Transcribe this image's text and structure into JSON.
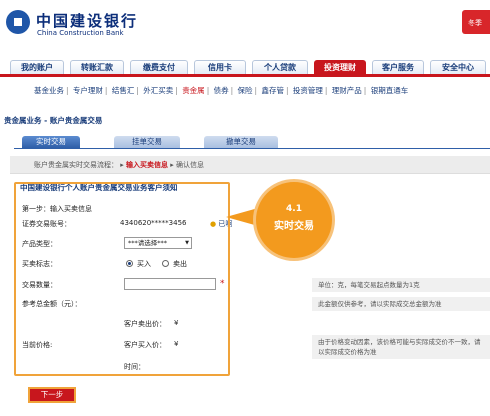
{
  "header": {
    "bank_name_cn": "中国建设银行",
    "bank_name_en": "China Construction Bank",
    "promo_text": "冬季"
  },
  "tabs": [
    {
      "label": "我的账户"
    },
    {
      "label": "转账汇款"
    },
    {
      "label": "缴费支付"
    },
    {
      "label": "信用卡"
    },
    {
      "label": "个人贷款"
    },
    {
      "label": "投资理财",
      "active": true
    },
    {
      "label": "客户服务"
    },
    {
      "label": "安全中心"
    }
  ],
  "subnav": [
    {
      "label": "基金业务"
    },
    {
      "label": "专户理财"
    },
    {
      "label": "结售汇"
    },
    {
      "label": "外汇买卖"
    },
    {
      "label": "贵金属",
      "active": true
    },
    {
      "label": "债券"
    },
    {
      "label": "保险"
    },
    {
      "label": "鑫存管"
    },
    {
      "label": "投资管理"
    },
    {
      "label": "理财产品"
    },
    {
      "label": "银期直通车"
    }
  ],
  "section_title": "贵金属业务 - 账户贵金属交易",
  "subtabs": [
    {
      "label": "实时交易",
      "active": true
    },
    {
      "label": "挂单交易"
    },
    {
      "label": "撤单交易"
    }
  ],
  "progress": {
    "prefix": "账户贵金属实时交易流程：",
    "current": "输入买卖信息",
    "next": "确认信息"
  },
  "notice_title": "中国建设银行个人账户贵金属交易业务客户须知",
  "form": {
    "step_label": "第一步：输入买卖信息",
    "account_label": "证券交易账号：",
    "account_value": "4340620*****3456",
    "account_link": "已啊",
    "product_label": "产品类型：",
    "product_select": "***请选择***",
    "direction_label": "买卖标志：",
    "buy_label": "买入",
    "sell_label": "卖出",
    "quantity_label": "交易数量：",
    "quantity_value": "",
    "required_mark": "*",
    "quantity_note": "单位：克，每笔交易起点数量为1克",
    "amount_label": "参考总金额（元）：",
    "amount_note": "此金额仅供参考，请以实际成交总金额为准",
    "sell_price_label": "客户卖出价：",
    "sell_price_value": "¥",
    "current_price_label": "当前价格:",
    "buy_price_label": "客户买入价：",
    "buy_price_value": "¥",
    "price_note": "由于价格变动因素，该价格可能与实际成交价不一致，请以实际成交价格为准",
    "time_label": "时间："
  },
  "callout": {
    "number": "4.1",
    "text": "实时交易"
  },
  "next_button": "下一步",
  "colors": {
    "brand_red": "#c8161d",
    "brand_blue": "#1a3d7a",
    "highlight": "#f39a1e"
  }
}
